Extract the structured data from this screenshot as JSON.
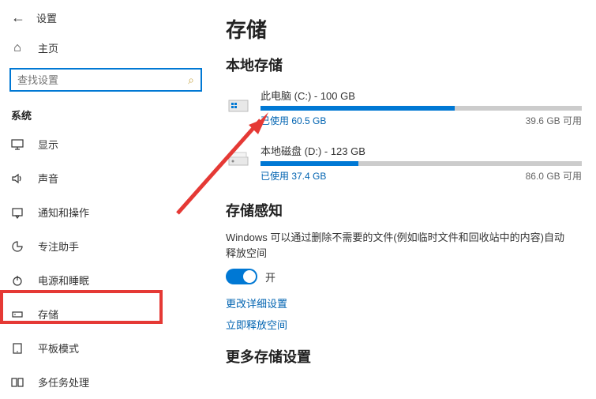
{
  "header": {
    "settings": "设置",
    "home": "主页"
  },
  "search": {
    "placeholder": "查找设置"
  },
  "section_label": "系统",
  "nav": [
    {
      "icon": "display",
      "label": "显示"
    },
    {
      "icon": "sound",
      "label": "声音"
    },
    {
      "icon": "notify",
      "label": "通知和操作"
    },
    {
      "icon": "focus",
      "label": "专注助手"
    },
    {
      "icon": "power",
      "label": "电源和睡眠"
    },
    {
      "icon": "storage",
      "label": "存储"
    },
    {
      "icon": "tablet",
      "label": "平板模式"
    },
    {
      "icon": "multitask",
      "label": "多任务处理"
    }
  ],
  "main": {
    "page_title": "存储",
    "local_storage_title": "本地存储",
    "drives": [
      {
        "name": "此电脑 (C:) - 100 GB",
        "used_label": "已使用 60.5 GB",
        "free_label": "39.6 GB 可用",
        "used_pct": 60.5,
        "icon": "windows"
      },
      {
        "name": "本地磁盘 (D:) - 123 GB",
        "used_label": "已使用 37.4 GB",
        "free_label": "86.0 GB 可用",
        "used_pct": 30.4,
        "icon": "hdd"
      }
    ],
    "sense_title": "存储感知",
    "sense_desc": "Windows 可以通过删除不需要的文件(例如临时文件和回收站中的内容)自动释放空间",
    "toggle_label": "开",
    "link_detail": "更改详细设置",
    "link_free": "立即释放空间",
    "more_title": "更多存储设置"
  }
}
